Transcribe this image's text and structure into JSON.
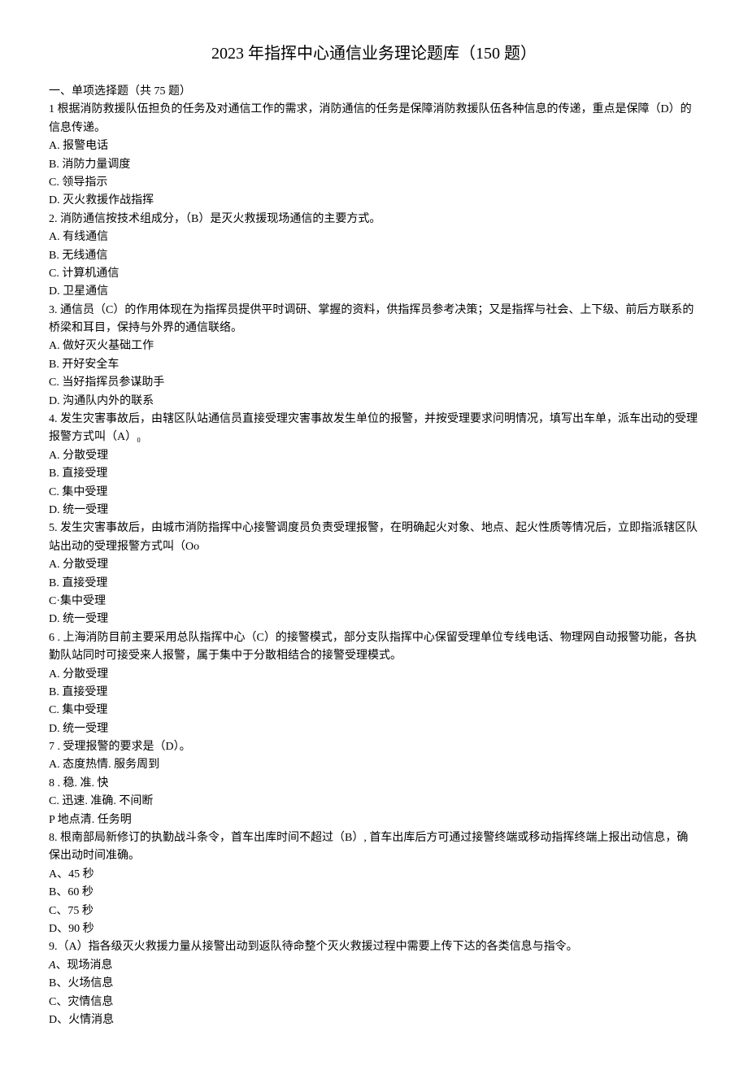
{
  "title": "2023 年指挥中心通信业务理论题库（150 题）",
  "section_header": "一、单项选择题（共 75 题）",
  "q1": {
    "stem": "1 根据消防救援队伍担负的任务及对通信工作的需求，消防通信的任务是保障消防救援队伍各种信息的传递，重点是保障（D）的信息传递。",
    "a": "A. 报警电话",
    "b": "B. 消防力量调度",
    "c": "C. 领导指示",
    "d": "D. 灭火救援作战指挥"
  },
  "q2": {
    "stem": "2. 消防通信按技术组成分，（B）是灭火救援现场通信的主要方式。",
    "a": "A. 有线通信",
    "b": "B. 无线通信",
    "c": "C. 计算机通信",
    "d": "D. 卫星通信"
  },
  "q3": {
    "stem": "3. 通信员（C）的作用体现在为指挥员提供平时调研、掌握的资料，供指挥员参考决策；又是指挥与社会、上下级、前后方联系的桥梁和耳目，保持与外界的通信联络。",
    "a": "A. 做好灭火基础工作",
    "b": "B. 开好安全车",
    "c": "C. 当好指挥员参谋助手",
    "d": "D. 沟通队内外的联系"
  },
  "q4": {
    "stem": "4. 发生灾害事故后，由辖区队站通信员直接受理灾害事故发生单位的报警，并按受理要求问明情况，填写出车单，派车出动的受理报警方式叫（A）₀",
    "a": "A. 分散受理",
    "b": "B. 直接受理",
    "c": "C. 集中受理",
    "d": "D. 统一受理"
  },
  "q5": {
    "stem": "5. 发生灾害事故后，由城市消防指挥中心接警调度员负责受理报警，在明确起火对象、地点、起火性质等情况后，立即指派辖区队站出动的受理报警方式叫（Oo",
    "a": "A. 分散受理",
    "b": "B. 直接受理",
    "c": "C·集中受理",
    "d": "D. 统一受理"
  },
  "q6": {
    "stem": "6 . 上海消防目前主要采用总队指挥中心（C）的接警模式，部分支队指挥中心保留受理单位专线电话、物理网自动报警功能，各执勤队站同时可接受来人报警，属于集中于分散相结合的接警受理模式。",
    "a": "A. 分散受理",
    "b": "B. 直接受理",
    "c": "C. 集中受理",
    "d": "D. 统一受理"
  },
  "q7": {
    "stem": "7 . 受理报警的要求是（D）。",
    "a": "A. 态度热情. 服务周到",
    "b": "8 . 稳. 准. 快",
    "c": "C. 迅速. 准确. 不间断",
    "d": "P 地点清. 任务明"
  },
  "q8": {
    "stem": "8. 根南部局新修订的执勤战斗条令，首车出库时间不超过（B）, 首车出库后方可通过接警终端或移动指挥终端上报出动信息，确保出动时间准确。",
    "a": "A、45 秒",
    "b": "B、60 秒",
    "c": "C、75 秒",
    "d": "D、90 秒"
  },
  "q9": {
    "stem": "9.（A）指各级灭火救援力量从接警出动到返队待命整个灭火救援过程中需要上传下达的各类信息与指令。",
    "a_prefix": "A",
    "a_rest": "、现场消息",
    "b": "B、火场信息",
    "c": "C、灾情信息",
    "d": "D、火情消息"
  }
}
